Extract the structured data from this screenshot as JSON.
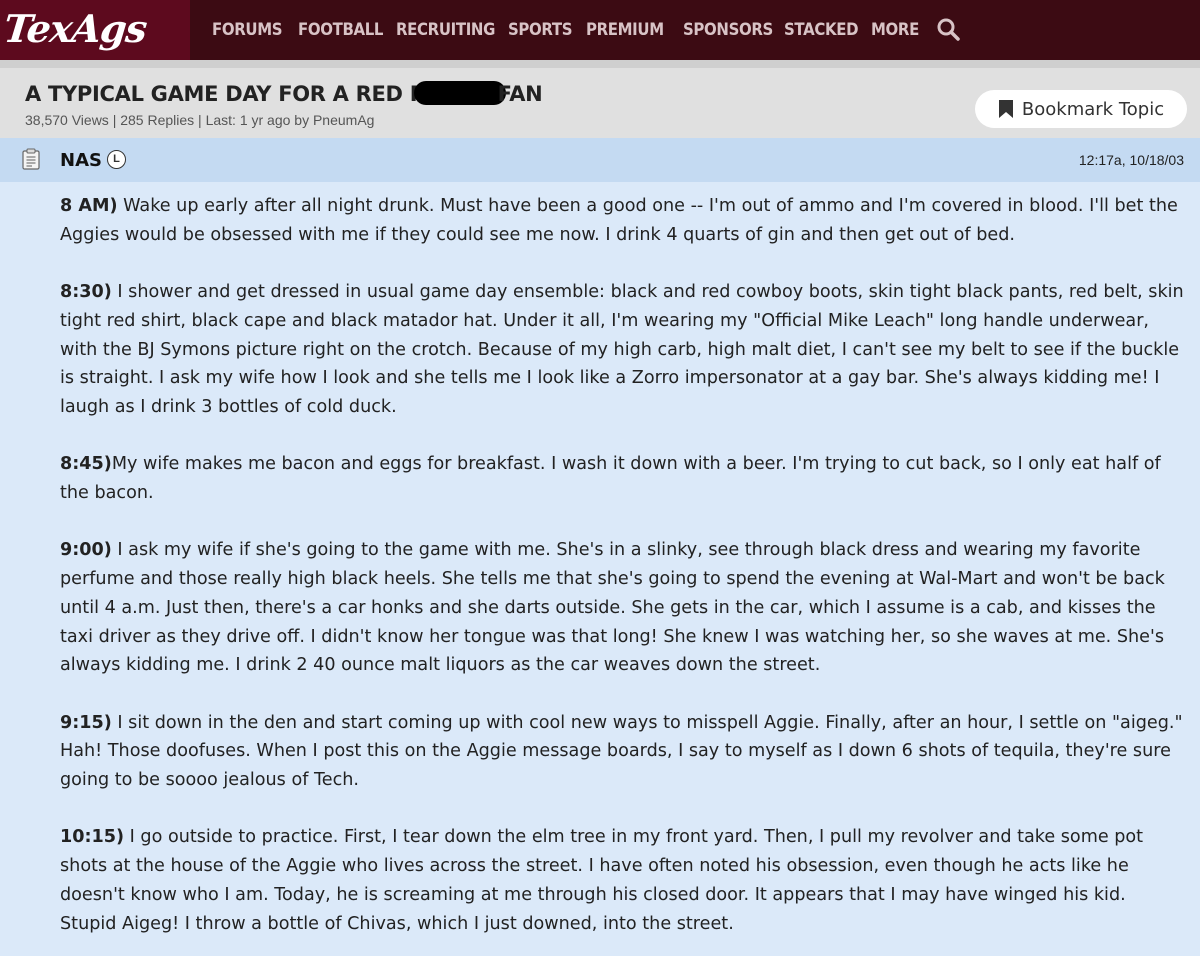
{
  "nav": {
    "logo": "TexAgs",
    "items": [
      "FORUMS",
      "FOOTBALL",
      "RECRUITING",
      "SPORTS",
      "PREMIUM",
      "SPONSORS",
      "STACKED",
      "MORE"
    ],
    "accent": "#3c0b13",
    "logo_bg": "#5d0a1e"
  },
  "topic": {
    "title_before": "A TYPICAL GAME DAY FOR A RED R",
    "title_after": "FAN",
    "meta": "38,570 Views | 285 Replies | Last: 1 yr ago by PneumAg",
    "bookmark_label": "Bookmark Topic"
  },
  "post": {
    "author": "NAS",
    "badge": "L",
    "timestamp": "12:17a, 10/18/03",
    "paragraphs": [
      {
        "time": "8 AM)",
        "text": " Wake up early after all night drunk. Must have been a good one -- I'm out of ammo and I'm covered in blood. I'll bet the Aggies would be obsessed with me if they could see me now. I drink 4 quarts of gin and then get out of bed."
      },
      {
        "time": "8:30)",
        "text": " I shower and get dressed in usual game day ensemble: black and red cowboy boots, skin tight black pants, red belt, skin tight red shirt, black cape and black matador hat. Under it all, I'm wearing my \"Official Mike Leach\" long handle underwear, with the BJ Symons picture right on the crotch. Because of my high carb, high malt diet, I can't see my belt to see if the buckle is straight. I ask my wife how I look and she tells me I look like a Zorro impersonator at a gay bar. She's always kidding me! I laugh as I drink 3 bottles of cold duck."
      },
      {
        "time": "8:45)",
        "text": "My wife makes me bacon and eggs for breakfast. I wash it down with a beer. I'm trying to cut back, so I only eat half of the bacon."
      },
      {
        "time": "9:00)",
        "text": " I ask my wife if she's going to the game with me. She's in a slinky, see through black dress and wearing my favorite perfume and those really high black heels. She tells me that she's going to spend the evening at Wal-Mart and won't be back until 4 a.m. Just then, there's a car honks and she darts outside. She gets in the car, which I assume is a cab, and kisses the taxi driver as they drive off. I didn't know her tongue was that long! She knew I was watching her, so she waves at me. She's always kidding me. I drink 2 40 ounce malt liquors as the car weaves down the street."
      },
      {
        "time": "9:15)",
        "text": " I sit down in the den and start coming up with cool new ways to misspell Aggie. Finally, after an hour, I settle on \"aigeg.\" Hah! Those doofuses. When I post this on the Aggie message boards, I say to myself as I down 6 shots of tequila, they're sure going to be soooo jealous of Tech."
      },
      {
        "time": "10:15)",
        "text": " I go outside to practice. First, I tear down the elm tree in my front yard. Then, I pull my revolver and take some pot shots at the house of the Aggie who lives across the street. I have often noted his obsession, even though he acts like he doesn't know who I am. Today, he is screaming at me through his closed door. It appears that I may have winged his kid. Stupid Aigeg! I throw a bottle of Chivas, which I just downed, into the street."
      }
    ]
  }
}
